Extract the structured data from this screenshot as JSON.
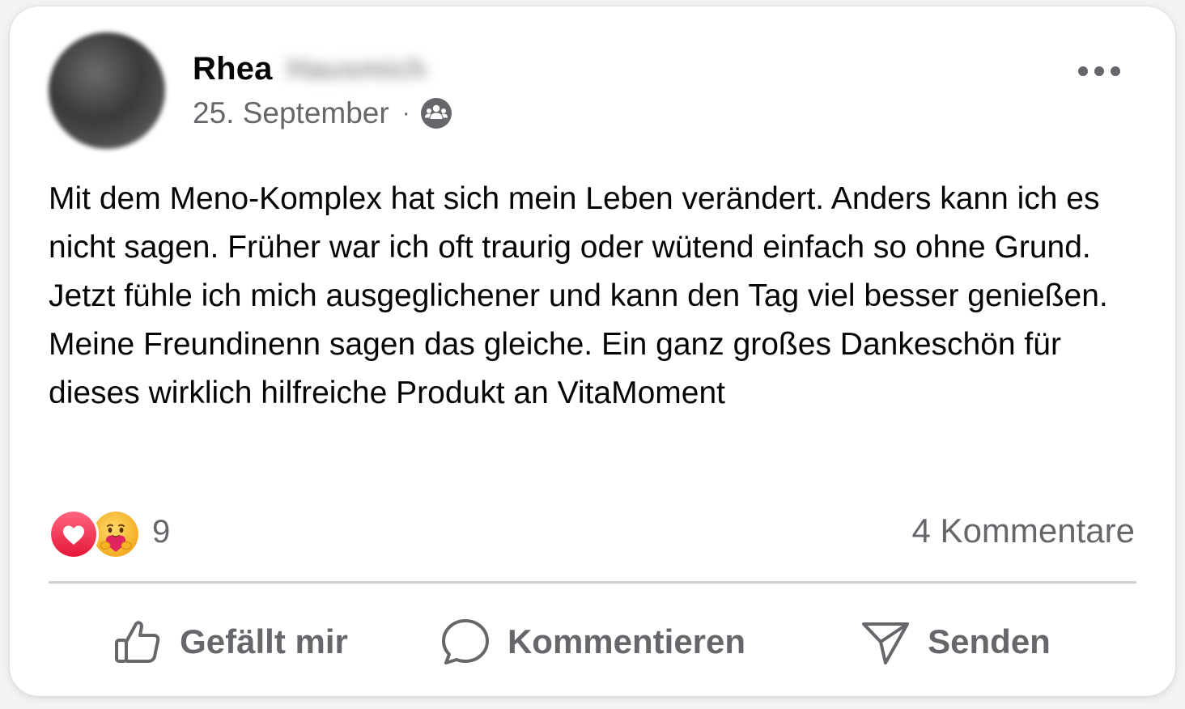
{
  "post": {
    "author_first_name": "Rhea",
    "author_last_name_blurred": "Hausmich",
    "date": "25. September",
    "separator": "·",
    "audience_icon": "friends-icon",
    "text": "Mit dem Meno-Komplex hat sich mein Leben verändert. Anders kann ich es nicht sagen. Früher war ich oft traurig oder wütend einfach so ohne Grund. Jetzt fühle ich mich ausgeglichener und kann den Tag viel besser genießen. Meine Freundinenn sagen das gleiche. Ein ganz großes Dankeschön für dieses wirklich hilfreiche Produkt an VitaMoment"
  },
  "reactions": {
    "icons": [
      "love-reaction-icon",
      "care-reaction-icon"
    ],
    "count": "9"
  },
  "comments": {
    "count_label": "4 Kommentare"
  },
  "actions": {
    "like_label": "Gefällt mir",
    "comment_label": "Kommentieren",
    "send_label": "Senden"
  },
  "colors": {
    "text_primary": "#050505",
    "text_secondary": "#65676b",
    "divider": "#ced0d4",
    "love_red": "#f33e58",
    "care_yellow": "#f7b125"
  }
}
